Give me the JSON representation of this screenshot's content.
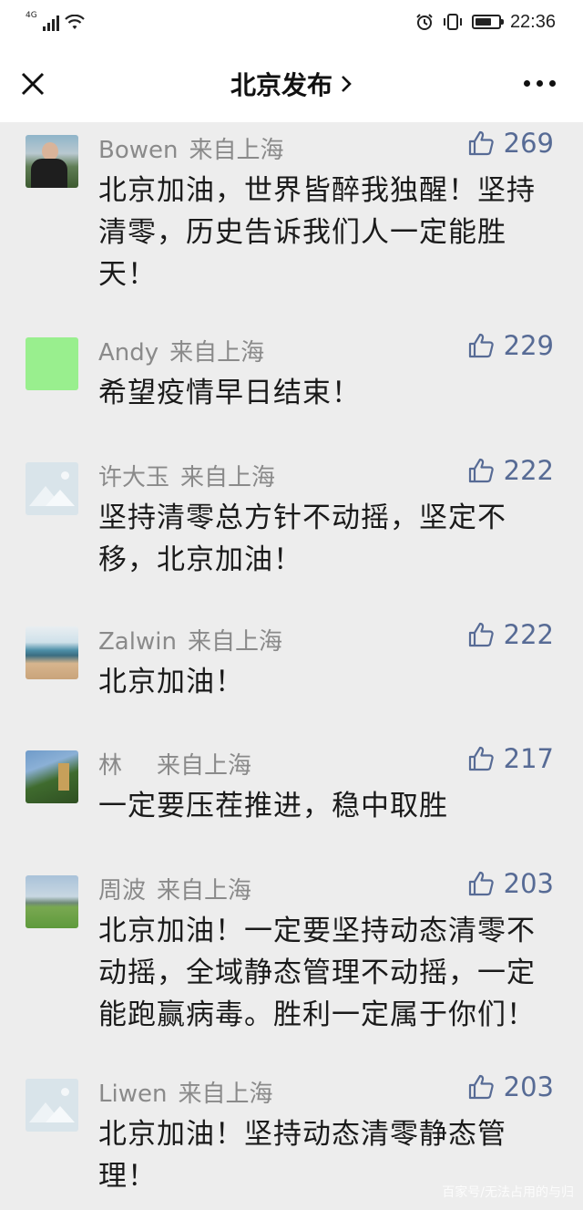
{
  "status_bar": {
    "network": "4G",
    "time": "22:36",
    "battery_level": 0.7,
    "icons": [
      "signal-icon",
      "wifi-icon",
      "alarm-icon",
      "vibrate-icon",
      "battery-icon"
    ]
  },
  "nav": {
    "title": "北京发布",
    "close_icon": "close-icon",
    "more_icon": "more-icon"
  },
  "colors": {
    "background": "#ededed",
    "like_blue": "#576b95",
    "name_gray": "#8a8a8a"
  },
  "comments": [
    {
      "name": "Bowen",
      "location": "来自上海",
      "likes": "269",
      "text": "北京加油，世界皆醉我独醒！坚持清零，历史告诉我们人一定能胜天！",
      "avatar": "photo-avatar"
    },
    {
      "name": "Andy",
      "location": "来自上海",
      "likes": "229",
      "text": "希望疫情早日结束！",
      "avatar": "green-avatar"
    },
    {
      "name": "许大玉",
      "location": "来自上海",
      "likes": "222",
      "text": "坚持清零总方针不动摇，坚定不移，北京加油！",
      "avatar": "placeholder-avatar"
    },
    {
      "name": "Zalwin",
      "location": "来自上海",
      "likes": "222",
      "text": "北京加油！",
      "avatar": "beach-avatar"
    },
    {
      "name": "林",
      "location": "来自上海",
      "likes": "217",
      "text": "一定要压茬推进，稳中取胜",
      "avatar": "tree-avatar"
    },
    {
      "name": "周波",
      "location": "来自上海",
      "likes": "203",
      "text": "北京加油！一定要坚持动态清零不动摇，全域静态管理不动摇，一定能跑赢病毒。胜利一定属于你们！",
      "avatar": "field-avatar"
    },
    {
      "name": "Liwen",
      "location": "来自上海",
      "likes": "203",
      "text": "北京加油！坚持动态清零静态管理！",
      "avatar": "placeholder-avatar"
    }
  ],
  "watermark": "百家号/无法占用的与归"
}
